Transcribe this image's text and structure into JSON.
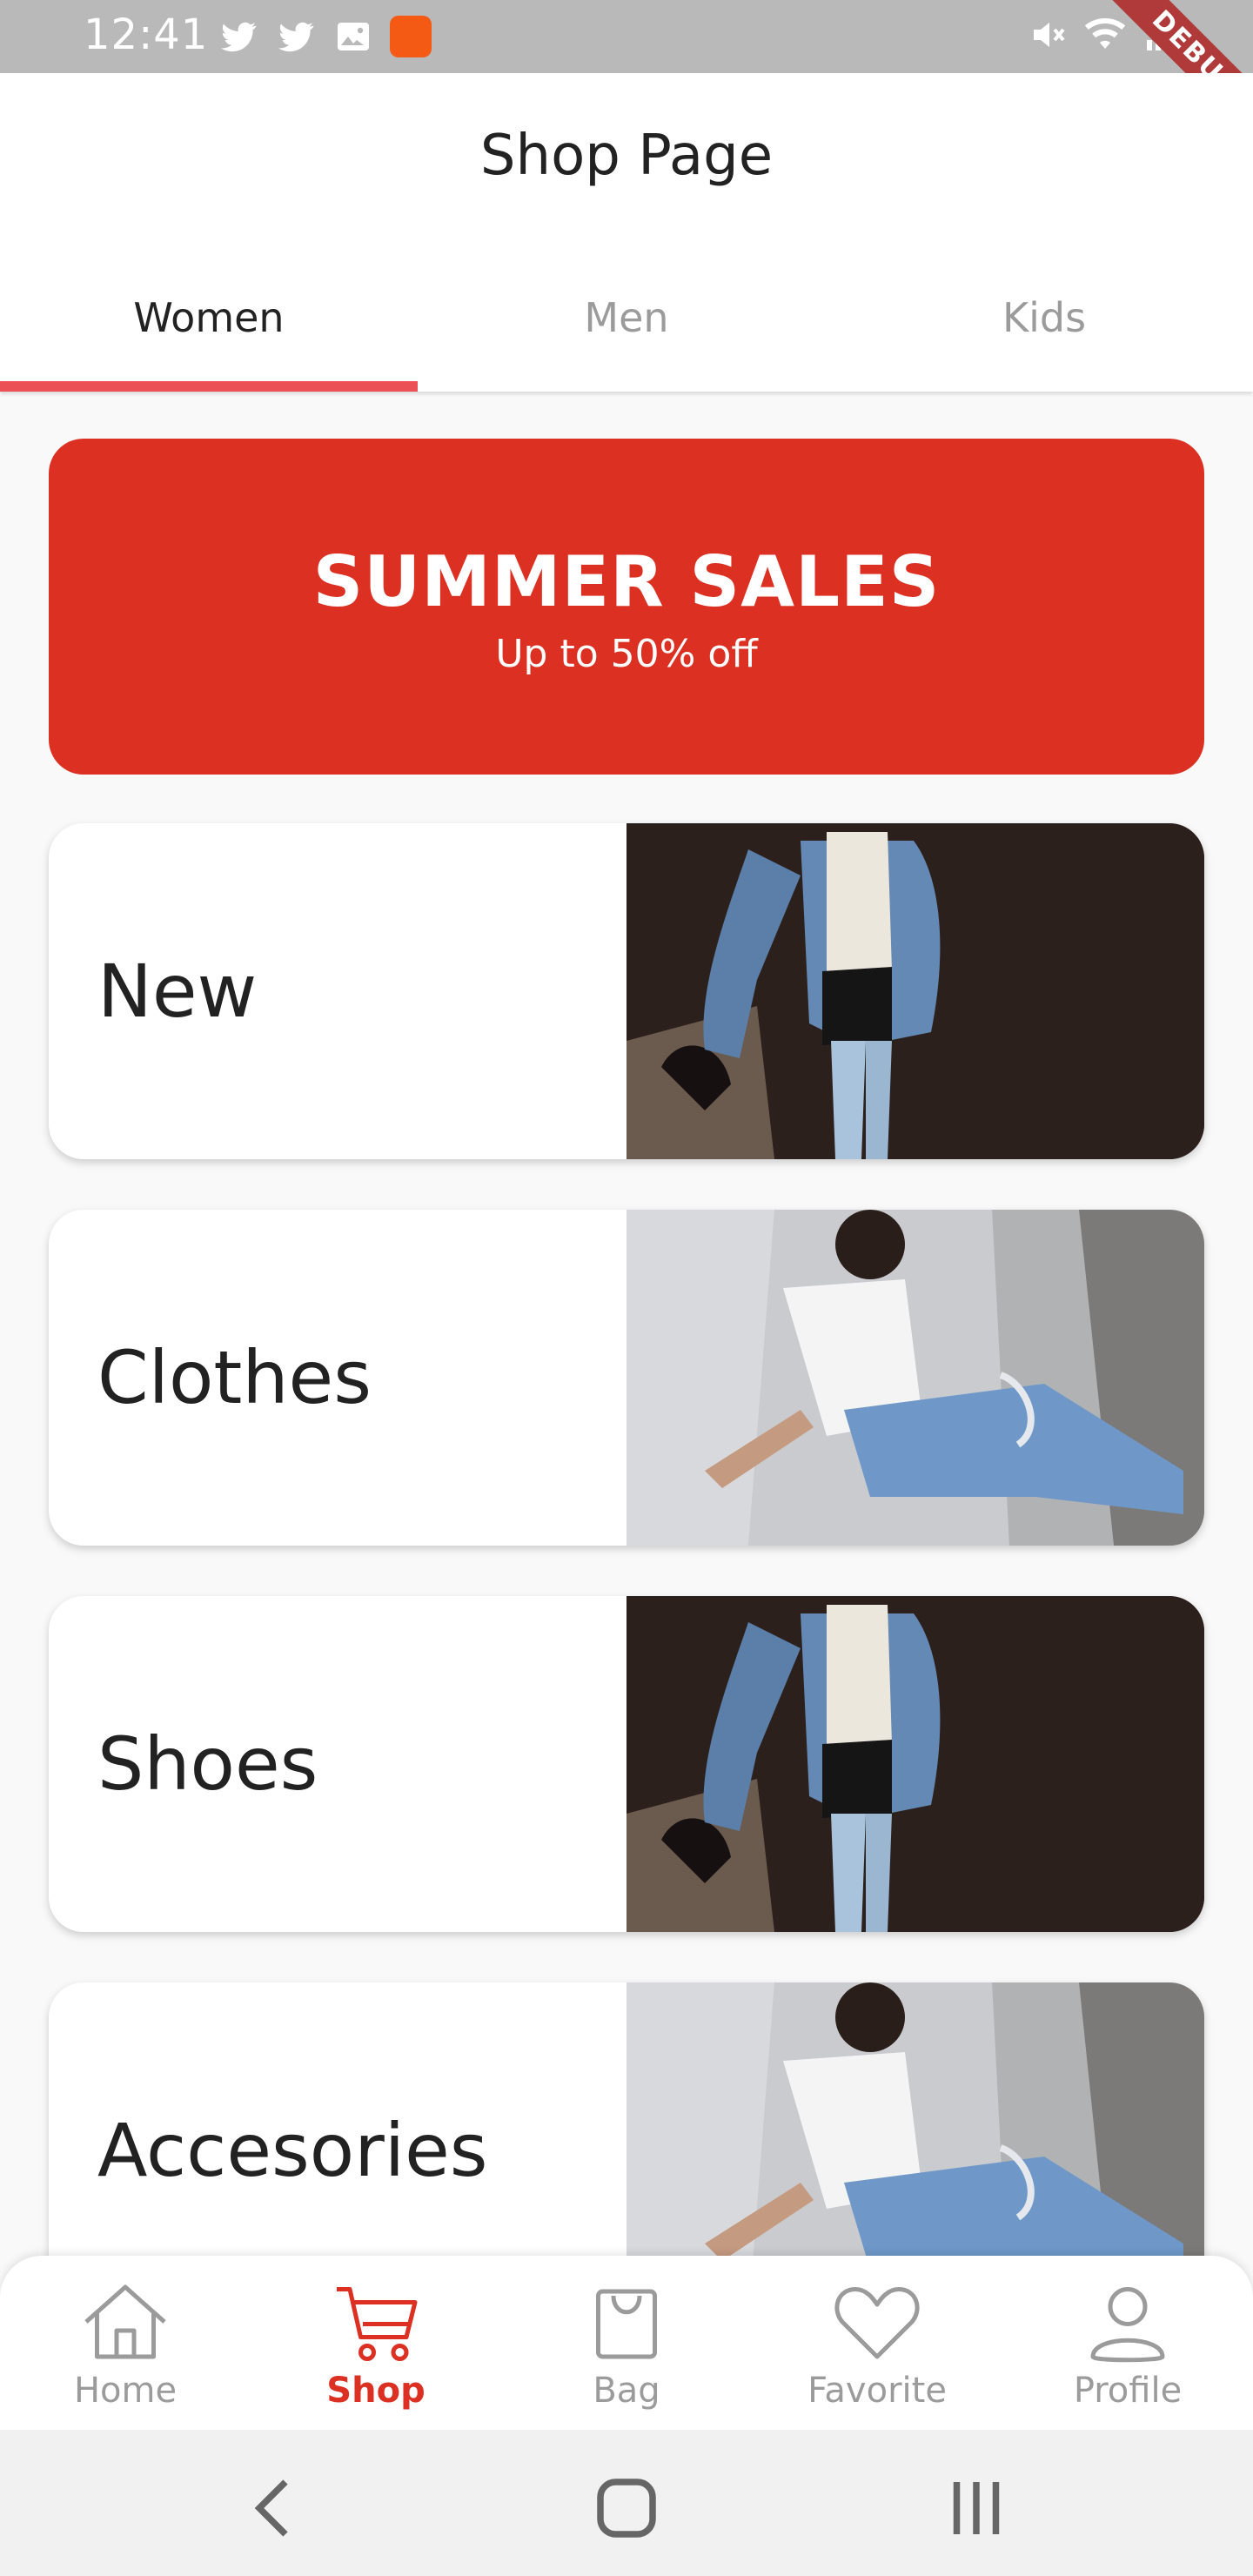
{
  "status_bar": {
    "time": "12:41",
    "left_icons": [
      "twitter-icon",
      "twitter-icon",
      "image-icon",
      "app-notification-icon"
    ],
    "right_icons": [
      "mute-icon",
      "wifi-icon",
      "signal-icon"
    ]
  },
  "debug_banner": "DEBUG",
  "app_bar": {
    "title": "Shop Page",
    "tabs": [
      {
        "label": "Women",
        "active": true
      },
      {
        "label": "Men",
        "active": false
      },
      {
        "label": "Kids",
        "active": false
      }
    ]
  },
  "promo": {
    "title": "SUMMER SALES",
    "subtitle": "Up to 50% off"
  },
  "categories": [
    {
      "label": "New",
      "image": "woman in denim jacket"
    },
    {
      "label": "Clothes",
      "image": "woman sitting in white t-shirt"
    },
    {
      "label": "Shoes",
      "image": "woman in denim jacket"
    },
    {
      "label": "Accesories",
      "image": "woman sitting in white t-shirt"
    }
  ],
  "bottom_nav": [
    {
      "label": "Home",
      "icon": "home-icon",
      "active": false
    },
    {
      "label": "Shop",
      "icon": "cart-icon",
      "active": true
    },
    {
      "label": "Bag",
      "icon": "bag-icon",
      "active": false
    },
    {
      "label": "Favorite",
      "icon": "heart-icon",
      "active": false
    },
    {
      "label": "Profile",
      "icon": "profile-icon",
      "active": false
    }
  ],
  "colors": {
    "accent": "#db3022",
    "tab_indicator": "#eb5057",
    "inactive_text": "#9b9b9b",
    "background": "#f9f9f9"
  }
}
